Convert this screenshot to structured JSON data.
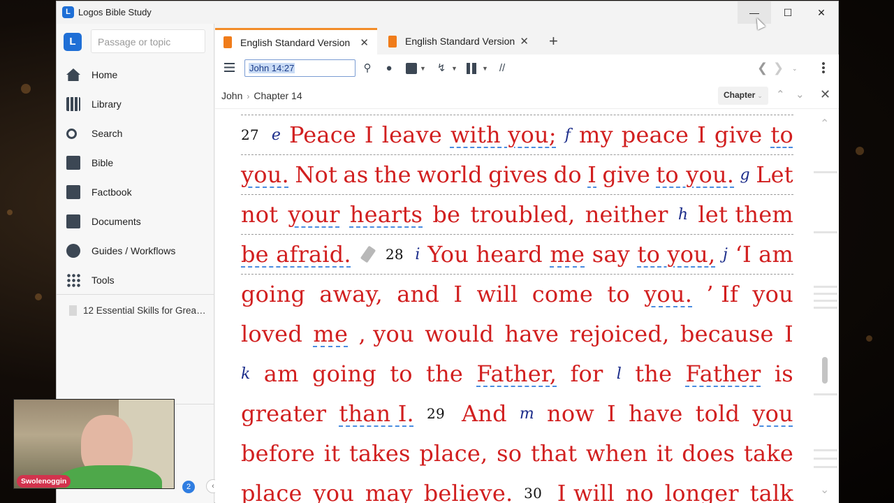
{
  "window": {
    "title": "Logos Bible Study",
    "buttons": {
      "minimize": "—",
      "maximize": "☐",
      "close": "✕"
    }
  },
  "sidebar": {
    "search_placeholder": "Passage or topic",
    "items": [
      {
        "label": "Home",
        "icon": "home-icon"
      },
      {
        "label": "Library",
        "icon": "library-icon"
      },
      {
        "label": "Search",
        "icon": "search-icon"
      },
      {
        "label": "Bible",
        "icon": "bible-icon"
      },
      {
        "label": "Factbook",
        "icon": "factbook-icon"
      },
      {
        "label": "Documents",
        "icon": "documents-icon"
      },
      {
        "label": "Guides / Workflows",
        "icon": "guides-icon"
      },
      {
        "label": "Tools",
        "icon": "tools-icon"
      }
    ],
    "recent": "12 Essential Skills for Grea…",
    "notification_count": "2",
    "collapse": "‹"
  },
  "tabs": [
    {
      "label": "English Standard Version",
      "close": "✕",
      "active": true
    },
    {
      "label": "English Standard Version",
      "close": "✕",
      "active": false
    }
  ],
  "new_tab": "+",
  "toolbar": {
    "reference": "John 14:27",
    "parallel_marker": "//"
  },
  "breadcrumb": {
    "book": "John",
    "separator": "›",
    "chapter": "Chapter 14"
  },
  "chapter_dropdown": {
    "label": "Chapter",
    "caret": "⌄"
  },
  "panel_close": "✕",
  "text_lines": [
    [
      {
        "t": "27",
        "c": "vnum"
      },
      {
        "t": "e",
        "c": "fn"
      },
      {
        "t": "Peace"
      },
      {
        "t": "I"
      },
      {
        "t": "leave"
      },
      {
        "t": "with you;",
        "c": "u"
      },
      {
        "t": "f",
        "c": "fn"
      },
      {
        "t": "my"
      },
      {
        "t": "peace"
      },
      {
        "t": "I"
      },
      {
        "t": "give"
      },
      {
        "t": "to",
        "c": "u"
      }
    ],
    [
      {
        "t": "you.",
        "c": "u"
      },
      {
        "t": "Not"
      },
      {
        "t": "as"
      },
      {
        "t": "the"
      },
      {
        "t": "world"
      },
      {
        "t": "gives"
      },
      {
        "t": "do"
      },
      {
        "t": "I",
        "c": "u"
      },
      {
        "t": "give"
      },
      {
        "t": "to you.",
        "c": "u"
      },
      {
        "t": "g",
        "c": "fn"
      },
      {
        "t": "Let"
      }
    ],
    [
      {
        "t": "not"
      },
      {
        "t": "your",
        "c": "u"
      },
      {
        "t": "hearts",
        "c": "u"
      },
      {
        "t": "be"
      },
      {
        "t": "troubled,"
      },
      {
        "t": "neither"
      },
      {
        "t": "h",
        "c": "fn"
      },
      {
        "t": "let them"
      }
    ],
    [
      {
        "t": "be afraid.",
        "c": "u"
      },
      {
        "t": "",
        "c": "pencil"
      },
      {
        "t": "28",
        "c": "vnum"
      },
      {
        "t": "i",
        "c": "fn"
      },
      {
        "t": "You heard"
      },
      {
        "t": "me",
        "c": "u"
      },
      {
        "t": "say"
      },
      {
        "t": "to you,",
        "c": "u"
      },
      {
        "t": "j",
        "c": "fn"
      },
      {
        "t": "‘I am"
      }
    ],
    [
      {
        "t": "going"
      },
      {
        "t": "away,"
      },
      {
        "t": "and"
      },
      {
        "t": "I"
      },
      {
        "t": "will"
      },
      {
        "t": "come"
      },
      {
        "t": "to"
      },
      {
        "t": "you.",
        "c": "u"
      },
      {
        "t": "’ If"
      },
      {
        "t": "you"
      }
    ],
    [
      {
        "t": "loved"
      },
      {
        "t": "me",
        "c": "u"
      },
      {
        "t": ", you"
      },
      {
        "t": "would"
      },
      {
        "t": "have"
      },
      {
        "t": "rejoiced,"
      },
      {
        "t": "because"
      },
      {
        "t": "I"
      }
    ],
    [
      {
        "t": "k",
        "c": "fn"
      },
      {
        "t": "am"
      },
      {
        "t": "going"
      },
      {
        "t": "to"
      },
      {
        "t": "the"
      },
      {
        "t": "Father,",
        "c": "u"
      },
      {
        "t": "for"
      },
      {
        "t": "l",
        "c": "fn"
      },
      {
        "t": "the"
      },
      {
        "t": "Father",
        "c": "u"
      },
      {
        "t": "is"
      }
    ],
    [
      {
        "t": "greater"
      },
      {
        "t": "than I.",
        "c": "u"
      },
      {
        "t": "29",
        "c": "vnum"
      },
      {
        "t": "And"
      },
      {
        "t": "m",
        "c": "fn"
      },
      {
        "t": "now"
      },
      {
        "t": "I"
      },
      {
        "t": "have"
      },
      {
        "t": "told"
      },
      {
        "t": "you",
        "c": "u"
      }
    ],
    [
      {
        "t": "before"
      },
      {
        "t": "it"
      },
      {
        "t": "takes"
      },
      {
        "t": "place,"
      },
      {
        "t": "so"
      },
      {
        "t": "that"
      },
      {
        "t": "when"
      },
      {
        "t": "it"
      },
      {
        "t": "does"
      },
      {
        "t": "take"
      }
    ],
    [
      {
        "t": "place"
      },
      {
        "t": "you"
      },
      {
        "t": "may"
      },
      {
        "t": "believe."
      },
      {
        "t": "30",
        "c": "vnum"
      },
      {
        "t": "I will"
      },
      {
        "t": "no"
      },
      {
        "t": "longer"
      },
      {
        "t": "talk"
      }
    ]
  ],
  "overlay": {
    "webcam_name": "Swolenoggin"
  },
  "colors": {
    "accent": "#1f6fd6",
    "tab_accent": "#f28c28",
    "words_of_christ": "#d11f1f",
    "footnote": "#1b2c8a"
  }
}
